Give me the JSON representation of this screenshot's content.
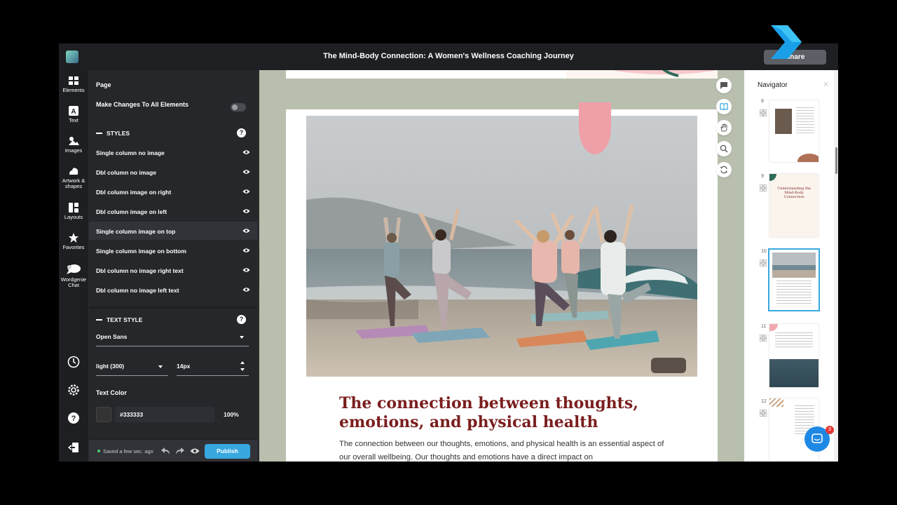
{
  "header": {
    "title": "The Mind-Body Connection: A Women's Wellness Coaching Journey",
    "share_label": "Share"
  },
  "rail": {
    "items": [
      {
        "label": "Elements",
        "icon": "elements-icon"
      },
      {
        "label": "Text",
        "icon": "text-icon"
      },
      {
        "label": "Images",
        "icon": "images-icon"
      },
      {
        "label": "Artwork & shapes",
        "icon": "artwork-icon"
      },
      {
        "label": "Layouts",
        "icon": "layouts-icon"
      },
      {
        "label": "Favorites",
        "icon": "star-icon"
      },
      {
        "label": "Wordgenie Chat",
        "icon": "chat-icon"
      }
    ]
  },
  "panel": {
    "page_label": "Page",
    "make_changes_label": "Make Changes To All Elements",
    "styles_label": "STYLES",
    "styles": [
      "Single column no image",
      "Dbl column no image",
      "Dbl column image on right",
      "Dbl column image on left",
      "Single column image on top",
      "Single column image on bottom",
      "Dbl column no image right text",
      "Dbl column no image left text"
    ],
    "text_style_label": "TEXT STYLE",
    "font_family": "Open Sans",
    "font_weight": "light (300)",
    "font_size": "14px",
    "text_color_label": "Text Color",
    "text_color_hex": "#333333",
    "opacity": "100%"
  },
  "footer": {
    "saved_status": "Saved a few sec. ago",
    "publish_label": "Publish"
  },
  "page": {
    "heading": "The connection between thoughts, emotions, and physical health",
    "body": "The connection between our thoughts, emotions, and physical health is an essential aspect of our overall wellbeing. Our thoughts and emotions have a direct impact on"
  },
  "navigator": {
    "title": "Navigator",
    "pages": [
      "8",
      "9",
      "10",
      "11",
      "12"
    ],
    "thumb_9_title": "Understanding the Mind-Body Connection"
  },
  "chat": {
    "badge": "3"
  },
  "colors": {
    "accent": "#38a8e0",
    "heading": "#7a1d1d",
    "text": "#333333"
  }
}
